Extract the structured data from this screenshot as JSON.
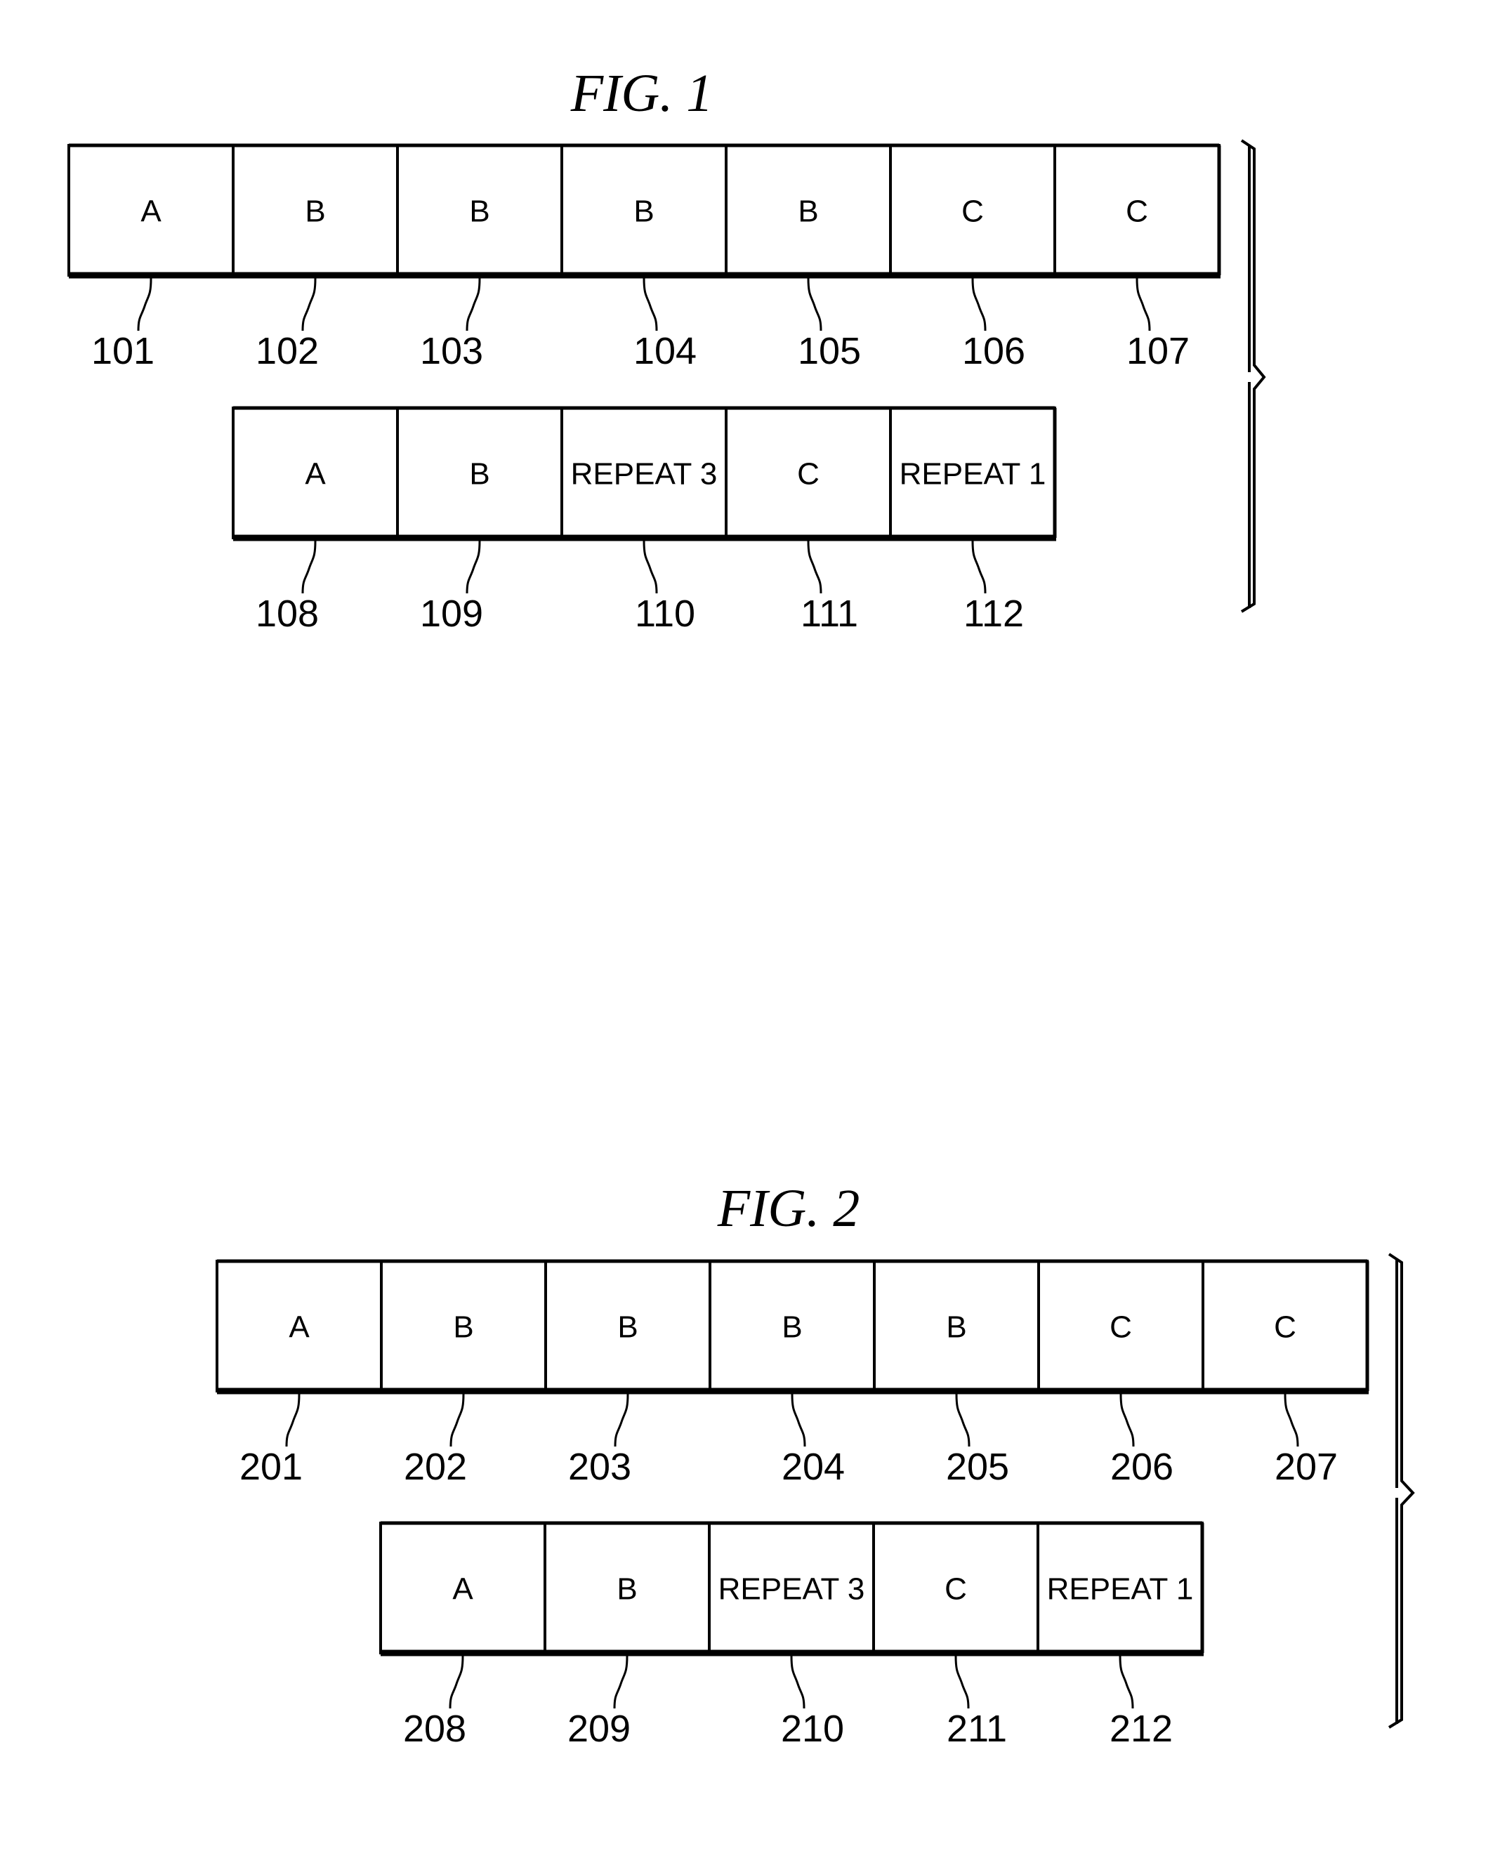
{
  "figures": [
    {
      "title": "FIG. 1",
      "rows": [
        {
          "name": "uncompressed-sequence",
          "cells": [
            {
              "label": "A",
              "ref": "101"
            },
            {
              "label": "B",
              "ref": "102"
            },
            {
              "label": "B",
              "ref": "103"
            },
            {
              "label": "B",
              "ref": "104"
            },
            {
              "label": "B",
              "ref": "105"
            },
            {
              "label": "C",
              "ref": "106"
            },
            {
              "label": "C",
              "ref": "107"
            }
          ]
        },
        {
          "name": "compressed-sequence",
          "cells": [
            {
              "label": "A",
              "ref": "108"
            },
            {
              "label": "B",
              "ref": "109"
            },
            {
              "label": "REPEAT 3",
              "ref": "110"
            },
            {
              "label": "C",
              "ref": "111"
            },
            {
              "label": "REPEAT 1",
              "ref": "112"
            }
          ]
        }
      ]
    },
    {
      "title": "FIG. 2",
      "rows": [
        {
          "name": "uncompressed-sequence",
          "cells": [
            {
              "label": "A",
              "ref": "201"
            },
            {
              "label": "B",
              "ref": "202"
            },
            {
              "label": "B",
              "ref": "203"
            },
            {
              "label": "B",
              "ref": "204"
            },
            {
              "label": "B",
              "ref": "205"
            },
            {
              "label": "C",
              "ref": "206"
            },
            {
              "label": "C",
              "ref": "207"
            }
          ]
        },
        {
          "name": "compressed-sequence",
          "cells": [
            {
              "label": "A",
              "ref": "208"
            },
            {
              "label": "B",
              "ref": "209"
            },
            {
              "label": "REPEAT 3",
              "ref": "210"
            },
            {
              "label": "C",
              "ref": "211"
            },
            {
              "label": "REPEAT 1",
              "ref": "212"
            }
          ]
        }
      ]
    }
  ]
}
